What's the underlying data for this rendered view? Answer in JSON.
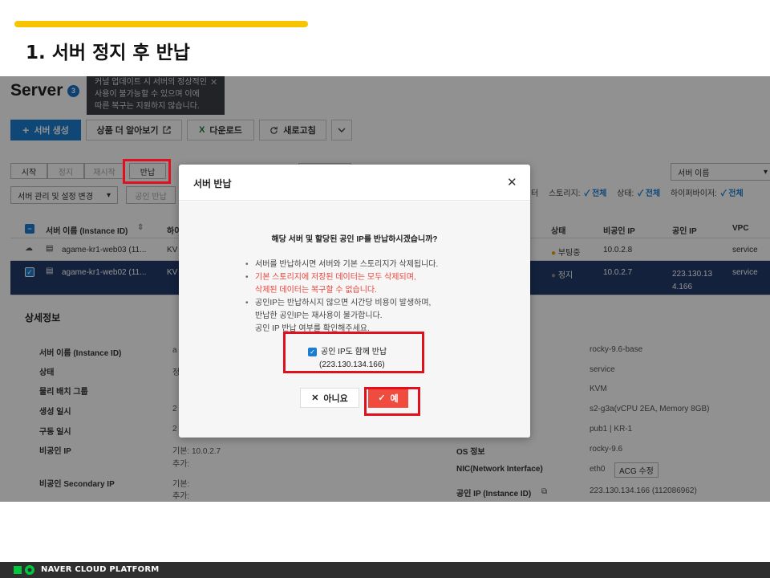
{
  "slide": {
    "title": "1. 서버 정지 후 반납",
    "footer_brand": "NAVER CLOUD PLATFORM"
  },
  "console": {
    "page_title": "Server",
    "count_badge": "3",
    "tooltip_lines": [
      "커널 업데이트 시 서버의 정상적인",
      "사용이 불가능할 수 있으며 이에",
      "따른 복구는 지원하지 않습니다."
    ],
    "toolbar": {
      "create": "서버 생성",
      "learn_more": "상품 더 알아보기",
      "download": "다운로드",
      "refresh": "새로고침"
    },
    "controls": {
      "start": "시작",
      "stop": "정지",
      "restart": "재시작",
      "return": "반납",
      "manage_dropdown": "서버 관리 및 설정 변경",
      "return_ip": "공인 반납",
      "search_select": "서버 이름"
    },
    "filter": {
      "storage_label": "스토리지:",
      "storage_value": "전체",
      "state_label": "상태:",
      "state_value": "전체",
      "hypervisor_label": "하이퍼바이저:",
      "hypervisor_value": "전체",
      "filter_partial": "터"
    },
    "table": {
      "headers": {
        "name": "서버 이름 (Instance ID)",
        "hyper_partial": "하이",
        "state": "상태",
        "private_ip": "비공인 IP",
        "public_ip": "공인 IP",
        "vpc": "VPC"
      },
      "rows": [
        {
          "name": "agame-kr1-web03 (11...",
          "hyper": "KV",
          "state": "부팅중",
          "private_ip": "10.0.2.8",
          "public_ip": "",
          "vpc": "service",
          "selected": false
        },
        {
          "name": "agame-kr1-web02 (11...",
          "hyper": "KV",
          "state": "정지",
          "private_ip": "10.0.2.7",
          "public_ip": "223.130.13 4.166",
          "vpc": "service",
          "selected": true
        }
      ]
    },
    "detail": {
      "title": "상세정보",
      "left_labels": [
        "서버 이름 (Instance ID)",
        "상태",
        "물리 배치 그룹",
        "생성 일시",
        "구동 일시",
        "비공인 IP",
        "비공인 Secondary IP"
      ],
      "left_values": {
        "name_partial": "a",
        "state_partial": "정",
        "created_partial": "2",
        "started_partial": "2",
        "private_ip_main": "기본: 10.0.2.7",
        "private_ip_extra": "추가:",
        "secondary_main": "기본:",
        "secondary_extra": "추가:"
      },
      "right_values": [
        "rocky-9.6-base",
        "service",
        "KVM",
        "s2-g3a(vCPU 2EA, Memory 8GB)",
        "pub1 | KR-1"
      ],
      "os_label": "OS 정보",
      "os_value": "rocky-9.6",
      "nic_label": "NIC(Network Interface)",
      "nic_value": "eth0",
      "acg_button": "ACG 수정",
      "public_ip_label": "공인 IP (Instance ID)",
      "public_ip_value": "223.130.134.166 (112086962)"
    }
  },
  "modal": {
    "title": "서버 반납",
    "question": "해당 서버 및 할당된 공인 IP를 반납하시겠습니까?",
    "note1": "서버를 반납하시면 서버와 기본 스토리지가 삭제됩니다.",
    "note2_line1": "기본 스토리지에 저장된 데이터는 모두 삭제되며,",
    "note2_line2": "삭제된 데이터는 복구할 수 없습니다.",
    "note3_line1": "공인IP는 반납하시지 않으면 시간당 비용이 발생하며,",
    "note3_line2": "반납한 공인IP는 재사용이 불가합니다.",
    "note3_line3": "공인 IP 반납 여부를 확인해주세요.",
    "checkbox_label": "공인 IP도 함께 반납",
    "checkbox_ip": "(223.130.134.166)",
    "no_button": "아니요",
    "yes_button": "예"
  },
  "colors": {
    "accent_yellow": "#f6c400",
    "primary_blue": "#1b7dd1",
    "danger_red": "#ef4c3f",
    "highlight_red": "#e0101e",
    "selected_row": "#233a6b"
  }
}
